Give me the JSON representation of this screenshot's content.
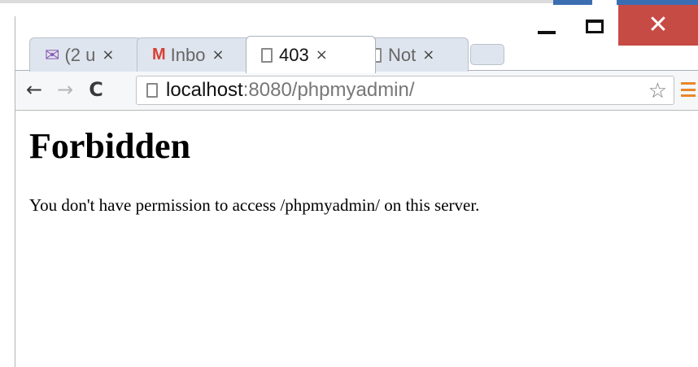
{
  "window": {
    "close_glyph": "✕"
  },
  "tabs": [
    {
      "title": "(2 u",
      "icon": "envelope-icon",
      "close": "×",
      "active": false
    },
    {
      "title": "Inbo",
      "icon": "gmail-icon",
      "close": "×",
      "active": false
    },
    {
      "title": "403",
      "icon": "page-icon",
      "close": "×",
      "active": true
    },
    {
      "title": "Not",
      "icon": "page-icon",
      "close": "×",
      "active": false
    }
  ],
  "toolbar": {
    "back": "←",
    "forward": "→",
    "reload": "C",
    "url_host": "localhost",
    "url_rest": ":8080/phpmyadmin/",
    "star": "☆"
  },
  "page": {
    "heading": "Forbidden",
    "message": "You don't have permission to access /phpmyadmin/ on this server."
  },
  "colors": {
    "close_button": "#c74b45",
    "menu_icon": "#e9872a",
    "envelope_icon": "#8b5ab6",
    "gmail_icon": "#d93f34"
  }
}
